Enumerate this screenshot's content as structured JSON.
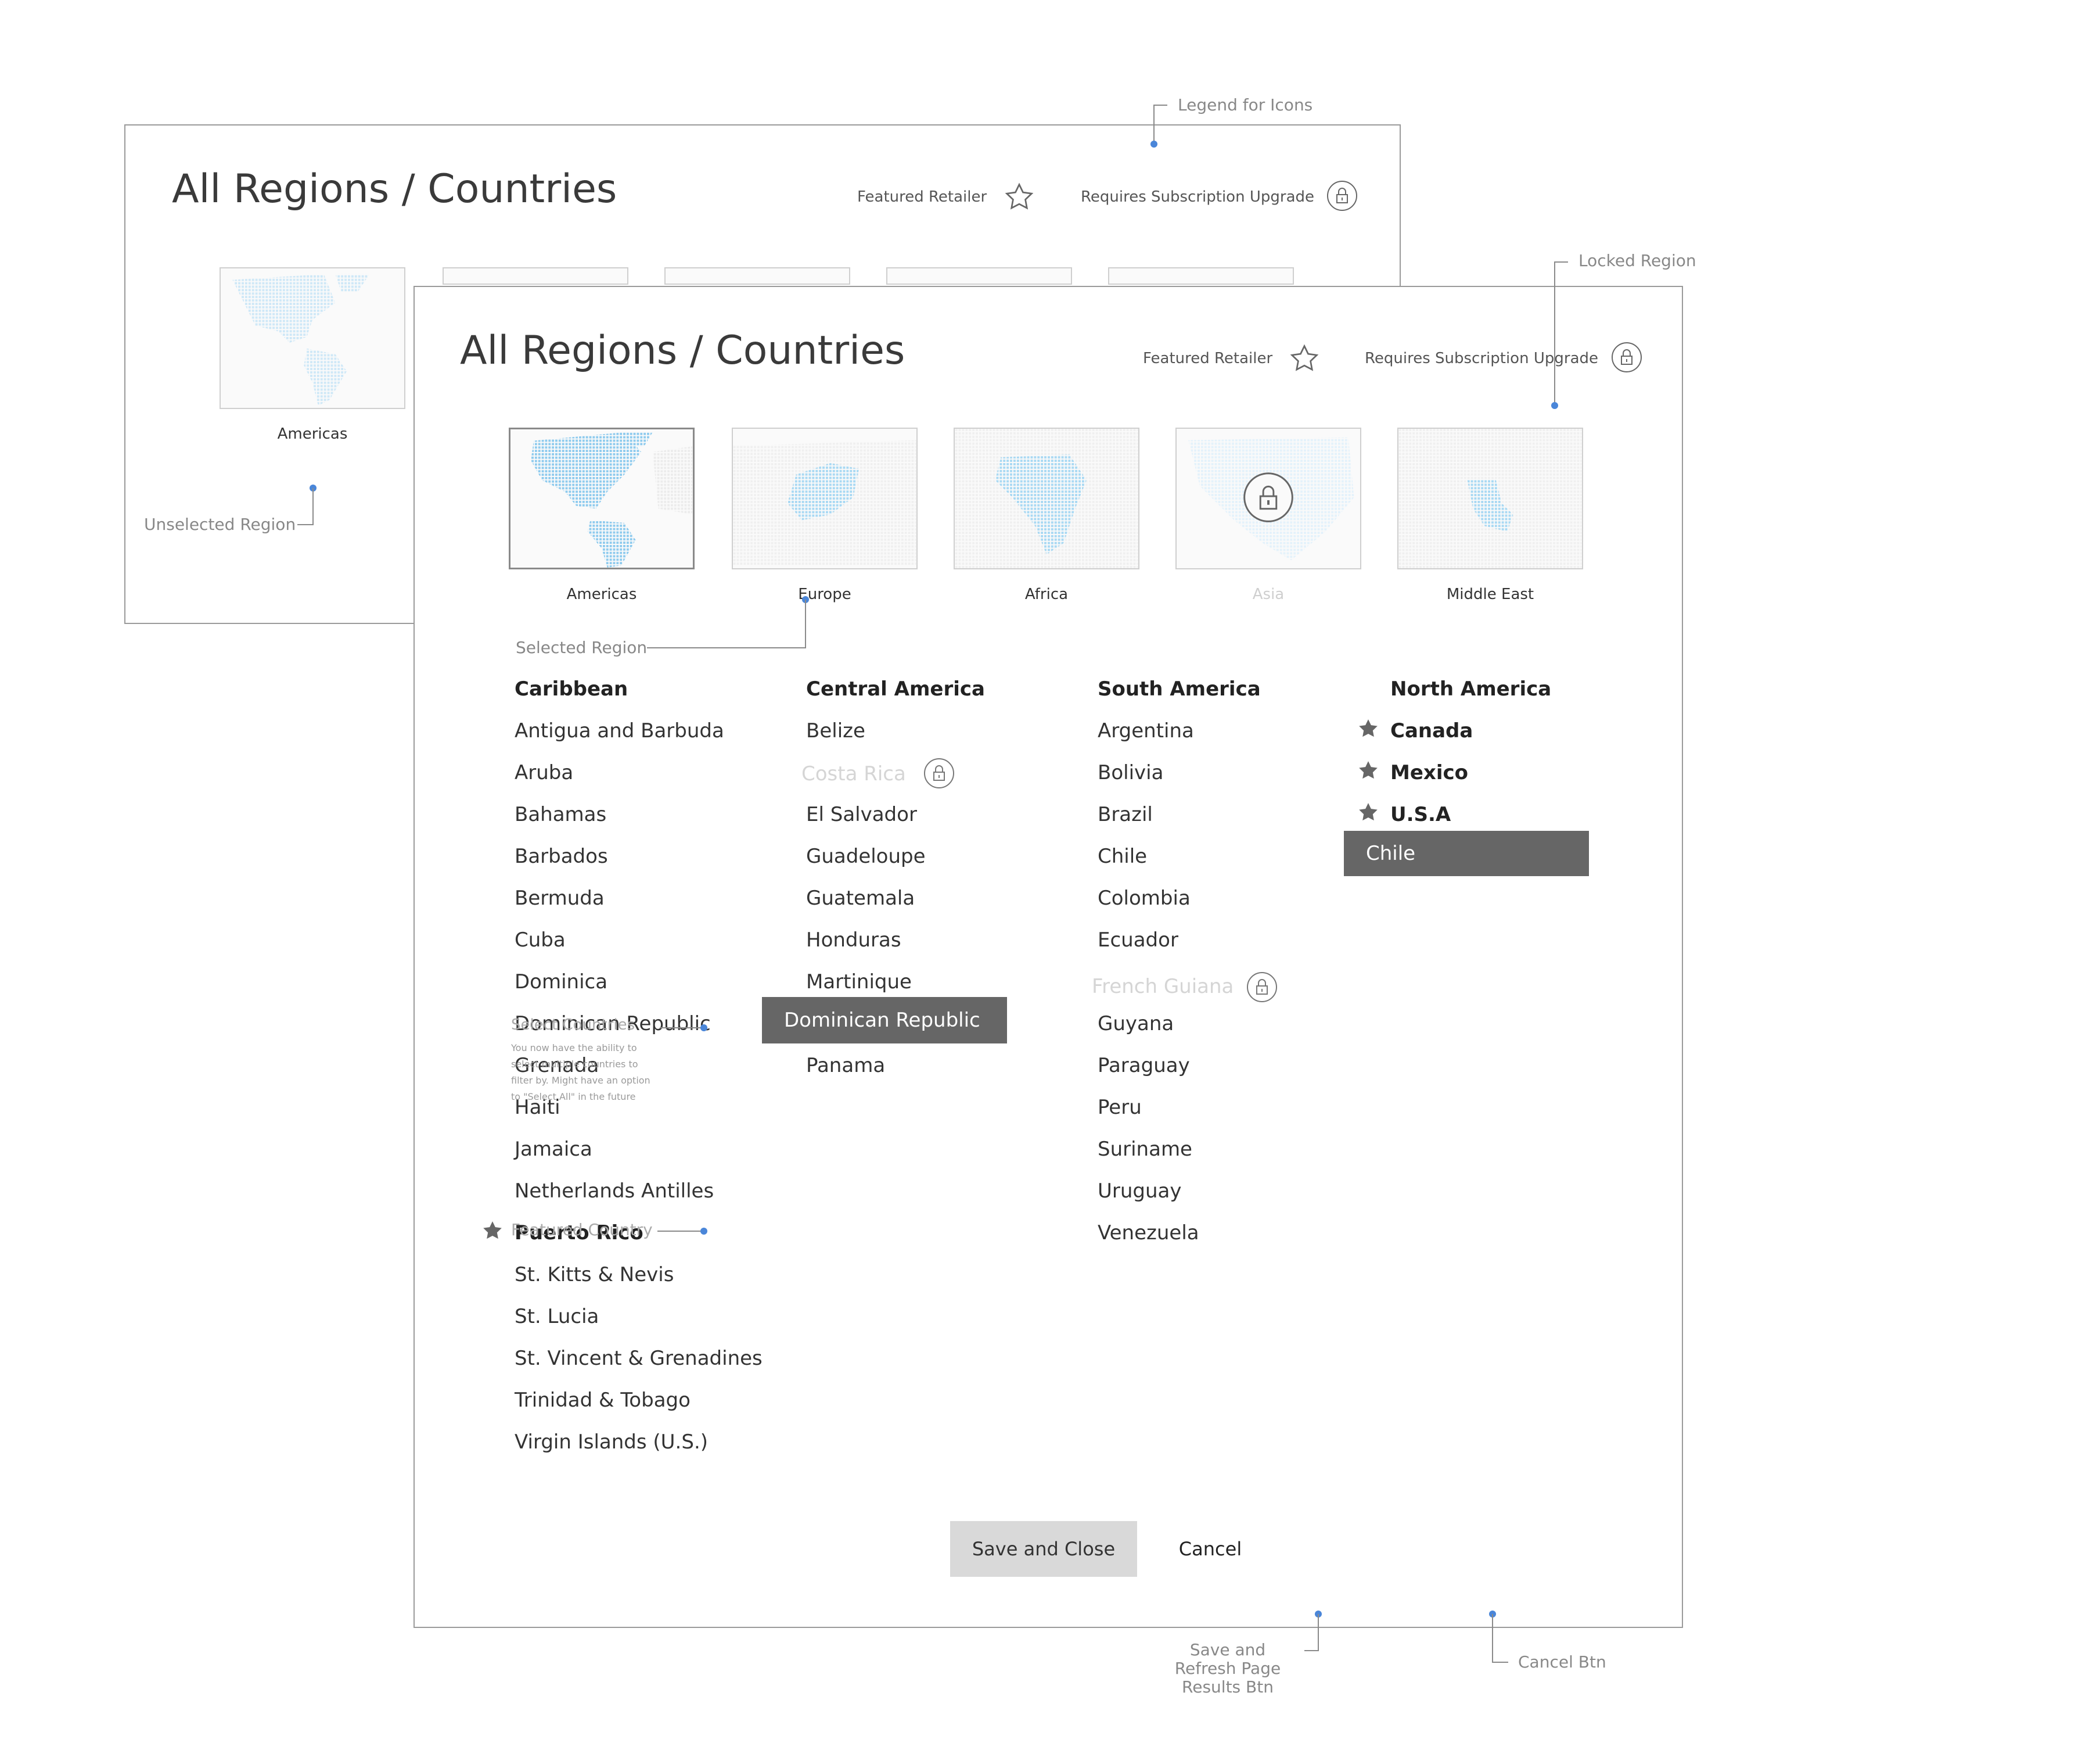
{
  "back_panel": {
    "title": "All Regions / Countries",
    "legend": {
      "featured_label": "Featured Retailer",
      "locked_label": "Requires Subscription Upgrade"
    },
    "region_label": "Americas"
  },
  "front_panel": {
    "title": "All Regions / Countries",
    "legend": {
      "featured_label": "Featured Retailer",
      "locked_label": "Requires Subscription Upgrade"
    },
    "regions": [
      {
        "label": "Americas",
        "state": "selected"
      },
      {
        "label": "Europe",
        "state": "unselected"
      },
      {
        "label": "Africa",
        "state": "unselected"
      },
      {
        "label": "Asia",
        "state": "locked"
      },
      {
        "label": "Middle East",
        "state": "unselected"
      }
    ],
    "columns": [
      {
        "heading": "Caribbean",
        "countries": [
          "Antigua and Barbuda",
          "Aruba",
          "Bahamas",
          "Barbados",
          "Bermuda",
          "Cuba",
          "Dominica",
          "Dominican Republic",
          "Grenada",
          "Haiti",
          "Jamaica",
          "Netherlands Antilles",
          "Puerto Rico",
          "St. Kitts & Nevis",
          "St. Lucia",
          "St. Vincent & Grenadines",
          "Trinidad & Tobago",
          "Virgin Islands (U.S.)"
        ]
      },
      {
        "heading": "Central America",
        "countries": [
          "Belize",
          "Costa Rica",
          "El Salvador",
          "Guadeloupe",
          "Guatemala",
          "Honduras",
          "Martinique",
          "Dominican Republic",
          "Panama"
        ]
      },
      {
        "heading": "South America",
        "countries": [
          "Argentina",
          "Bolivia",
          "Brazil",
          "Chile",
          "Colombia",
          "Ecuador",
          "French Guiana",
          "Guyana",
          "Paraguay",
          "Peru",
          "Suriname",
          "Uruguay",
          "Venezuela"
        ]
      },
      {
        "heading": "North America",
        "countries": [
          "Canada",
          "Mexico",
          "U.S.A",
          "Chile"
        ]
      }
    ],
    "buttons": {
      "save": "Save and Close",
      "cancel": "Cancel"
    }
  },
  "annotations": {
    "legend_for_icons": "Legend for Icons",
    "locked_region": "Locked Region",
    "unselected_region": "Unselected Region",
    "selected_region": "Selected Region",
    "featured_country": "Featured Country",
    "select_countries_title": "Select Countries",
    "select_countries_note": "You now have the ability to select multiple countries to filter by. Might have an option to \"Select All\" in the future",
    "save_btn": "Save and Refresh Page Results Btn",
    "cancel_btn": "Cancel Btn"
  },
  "colors": {
    "dot": "#4a86d9",
    "map_fill": "#9fd3f0",
    "highlight": "#666666",
    "button_bg": "#d9d9d9"
  },
  "icons": {
    "featured": "star-icon",
    "locked": "lock-icon"
  }
}
